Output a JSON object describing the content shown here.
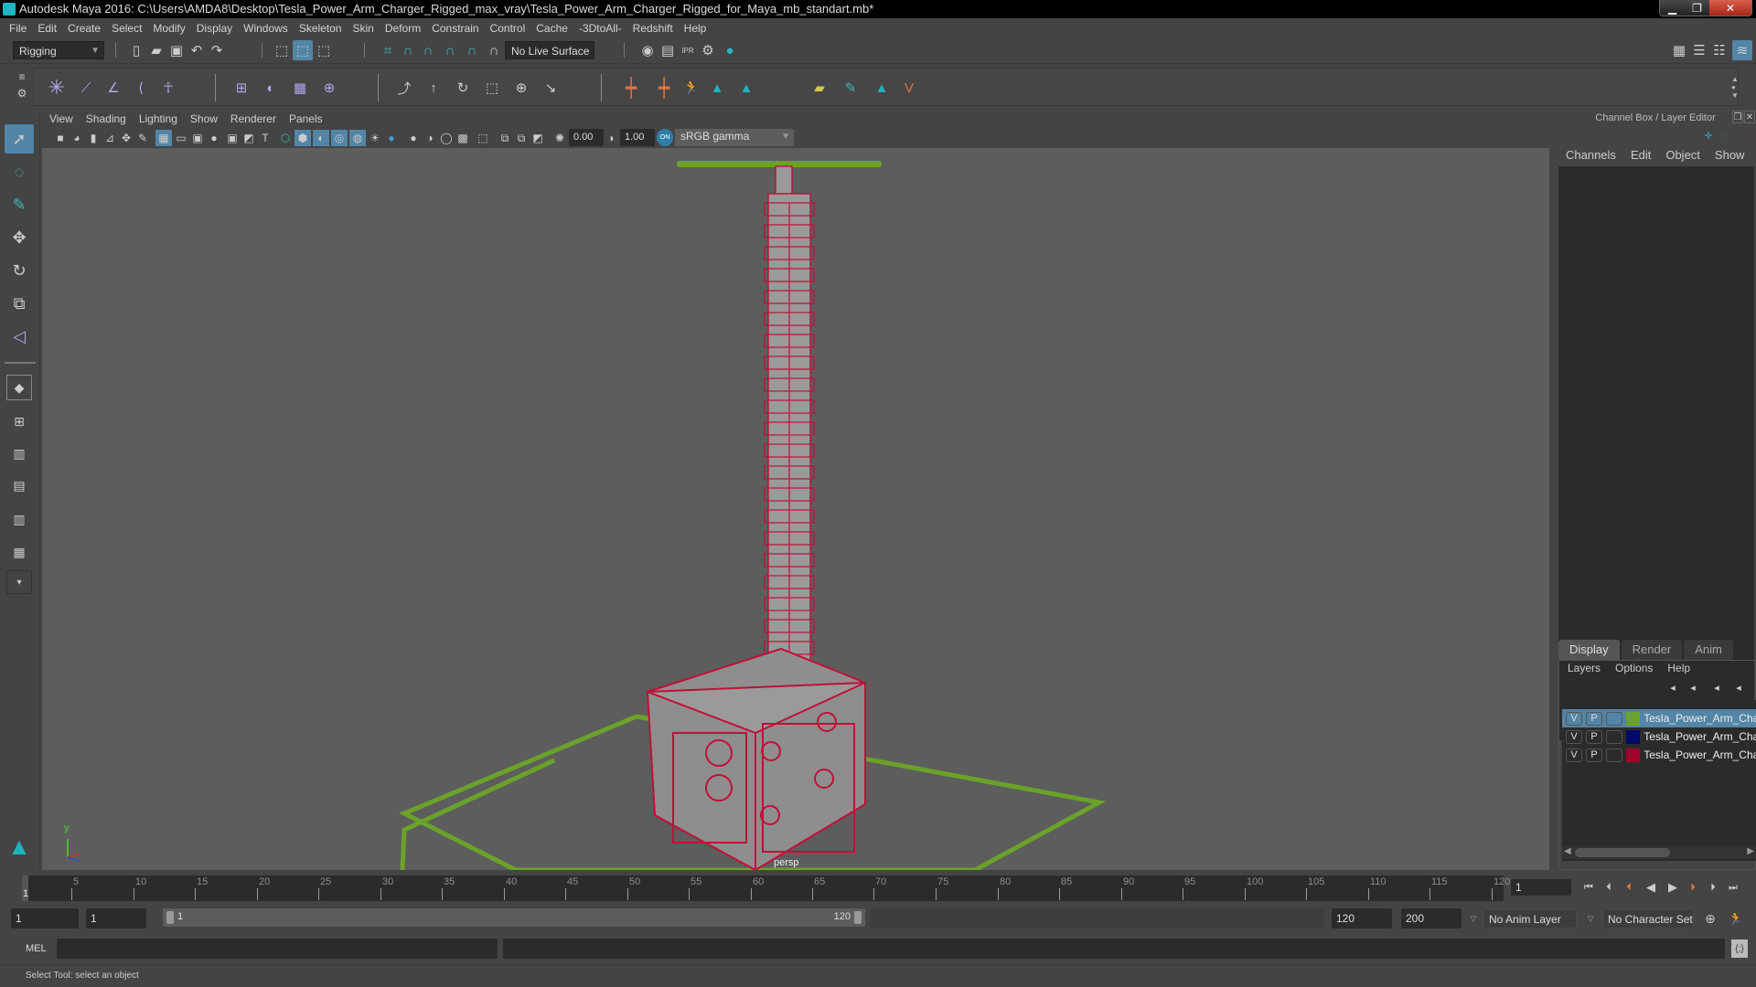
{
  "window": {
    "title": "Autodesk Maya 2016: C:\\Users\\AMDA8\\Desktop\\Tesla_Power_Arm_Charger_Rigged_max_vray\\Tesla_Power_Arm_Charger_Rigged_for_Maya_mb_standart.mb*",
    "minimize": "▁",
    "restore": "❐",
    "close": "✕"
  },
  "menubar": [
    "File",
    "Edit",
    "Create",
    "Select",
    "Modify",
    "Display",
    "Windows",
    "Skeleton",
    "Skin",
    "Deform",
    "Constrain",
    "Control",
    "Cache",
    "-3DtoAll-",
    "Redshift",
    "Help"
  ],
  "statusline": {
    "menuset": "Rigging",
    "live_surface": "No Live Surface"
  },
  "viewport": {
    "panel_menu": [
      "View",
      "Shading",
      "Lighting",
      "Show",
      "Renderer",
      "Panels"
    ],
    "exposure": "0.00",
    "gamma": "1.00",
    "color_space": "sRGB gamma",
    "camera_label": "persp",
    "axis_label_y": "y",
    "colors": {
      "wireframe": "#c0103a",
      "grid": "#6aa22a",
      "background": "#5d5d5d"
    }
  },
  "channel_box": {
    "title": "Channel Box / Layer Editor",
    "menu": [
      "Channels",
      "Edit",
      "Object",
      "Show"
    ]
  },
  "layer_editor": {
    "tabs": [
      "Display",
      "Render",
      "Anim"
    ],
    "active_tab": "Display",
    "menu": [
      "Layers",
      "Options",
      "Help"
    ],
    "layers": [
      {
        "v": "V",
        "p": "P",
        "color": "#6aa22a",
        "name": "Tesla_Power_Arm_Char",
        "selected": true
      },
      {
        "v": "V",
        "p": "P",
        "color": "#000a6a",
        "name": "Tesla_Power_Arm_Char",
        "selected": false
      },
      {
        "v": "V",
        "p": "P",
        "color": "#a0002a",
        "name": "Tesla_Power_Arm_Char",
        "selected": false
      }
    ]
  },
  "timeline": {
    "ticks": [
      "5",
      "10",
      "15",
      "20",
      "25",
      "30",
      "35",
      "40",
      "45",
      "50",
      "55",
      "60",
      "65",
      "70",
      "75",
      "80",
      "85",
      "90",
      "95",
      "100",
      "105",
      "110",
      "115",
      "120"
    ],
    "start_marker": "1",
    "current_frame": "1"
  },
  "range": {
    "start": "1",
    "playback_start": "1",
    "slider_start": "1",
    "slider_end": "120",
    "playback_end": "120",
    "end": "200",
    "anim_layer": "No Anim Layer",
    "character_set": "No Character Set"
  },
  "command_line": {
    "label": "MEL"
  },
  "help_line": {
    "text": "Select Tool: select an object"
  }
}
